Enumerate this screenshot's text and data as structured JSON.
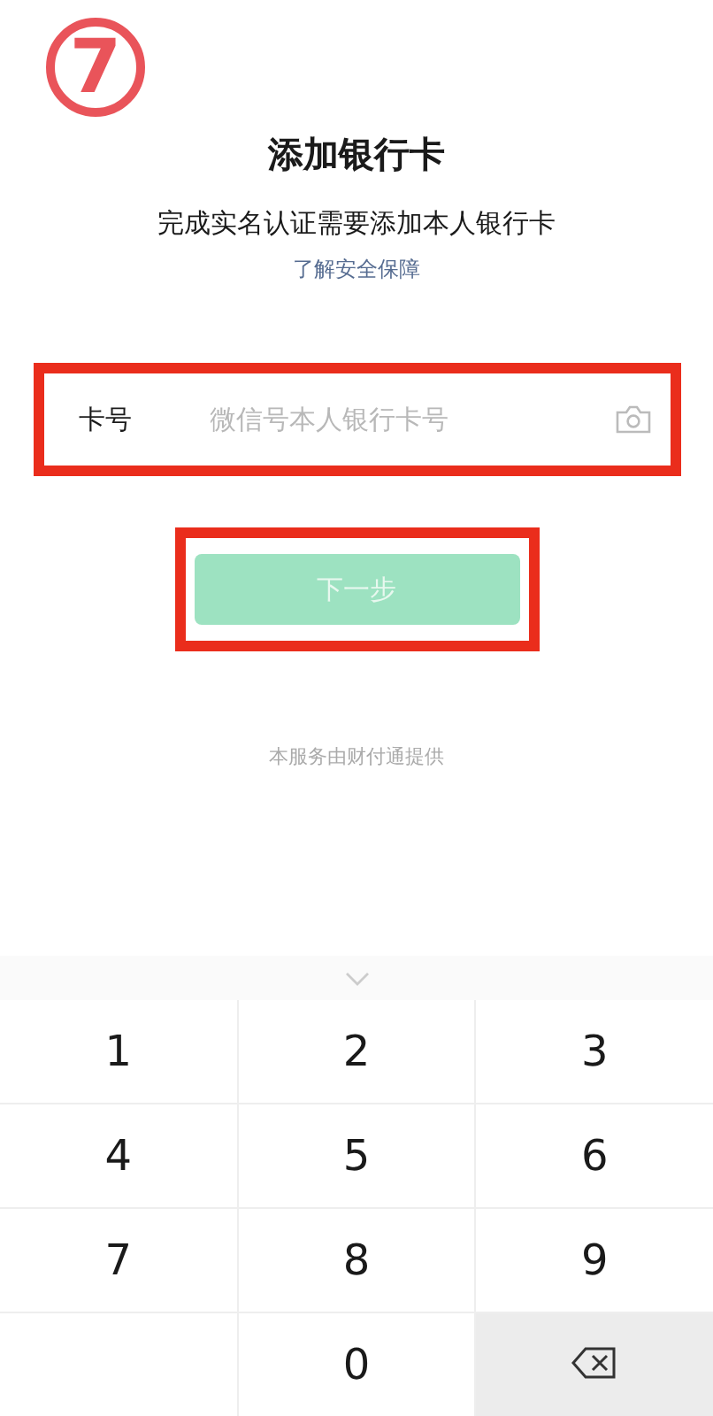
{
  "step_marker": "7",
  "title": "添加银行卡",
  "subtitle": "完成实名认证需要添加本人银行卡",
  "security_link": "了解安全保障",
  "card_field": {
    "label": "卡号",
    "placeholder": "微信号本人银行卡号",
    "highlighted": true
  },
  "next_button": {
    "label": "下一步",
    "disabled": true,
    "highlighted": true
  },
  "footer_note": "本服务由财付通提供",
  "keypad": {
    "keys": [
      {
        "kind": "digit",
        "label": "1"
      },
      {
        "kind": "digit",
        "label": "2"
      },
      {
        "kind": "digit",
        "label": "3"
      },
      {
        "kind": "digit",
        "label": "4"
      },
      {
        "kind": "digit",
        "label": "5"
      },
      {
        "kind": "digit",
        "label": "6"
      },
      {
        "kind": "digit",
        "label": "7"
      },
      {
        "kind": "digit",
        "label": "8"
      },
      {
        "kind": "digit",
        "label": "9"
      },
      {
        "kind": "blank"
      },
      {
        "kind": "digit",
        "label": "0"
      },
      {
        "kind": "delete"
      }
    ]
  }
}
